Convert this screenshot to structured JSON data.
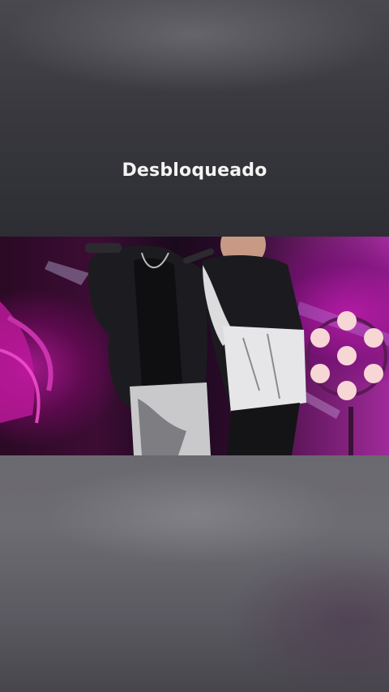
{
  "overlay": {
    "status_text": "Desbloqueado"
  },
  "colors": {
    "stage_magenta": "#a0188a",
    "stage_light": "#f3c9c9",
    "text": "#f4f4f4"
  }
}
